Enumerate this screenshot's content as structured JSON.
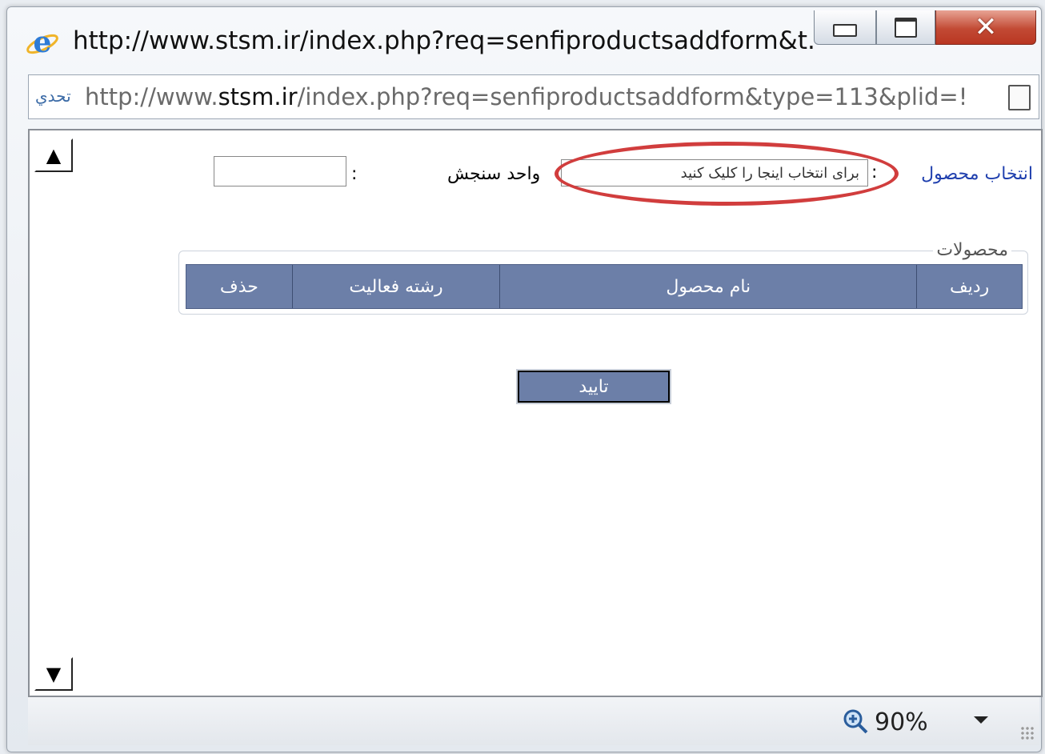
{
  "window": {
    "title": "http://www.stsm.ir/index.php?req=senfiproductsaddform&t...",
    "icon": "internet-explorer-icon"
  },
  "address": {
    "prefix": "http://www.",
    "domain": "stsm.ir",
    "path": "/index.php?req=senfiproductsaddform&type=113&plid=!",
    "leading_icon_text": "تحدي"
  },
  "form": {
    "select_product_link": "انتخاب محصول",
    "product_colon": ":",
    "product_placeholder": "برای انتخاب اینجا را کلیک کنید",
    "unit_label": "واحد سنجش",
    "unit_colon": ":",
    "unit_value": ""
  },
  "products": {
    "legend": "محصولات",
    "columns": [
      "ردیف",
      "نام محصول",
      "رشته فعالیت",
      "حذف"
    ]
  },
  "confirm_label": "تایید",
  "status": {
    "zoom": "90%"
  },
  "colors": {
    "header_bg": "#6c7fa8",
    "highlight": "#d13d3d",
    "link": "#1f3fae"
  }
}
